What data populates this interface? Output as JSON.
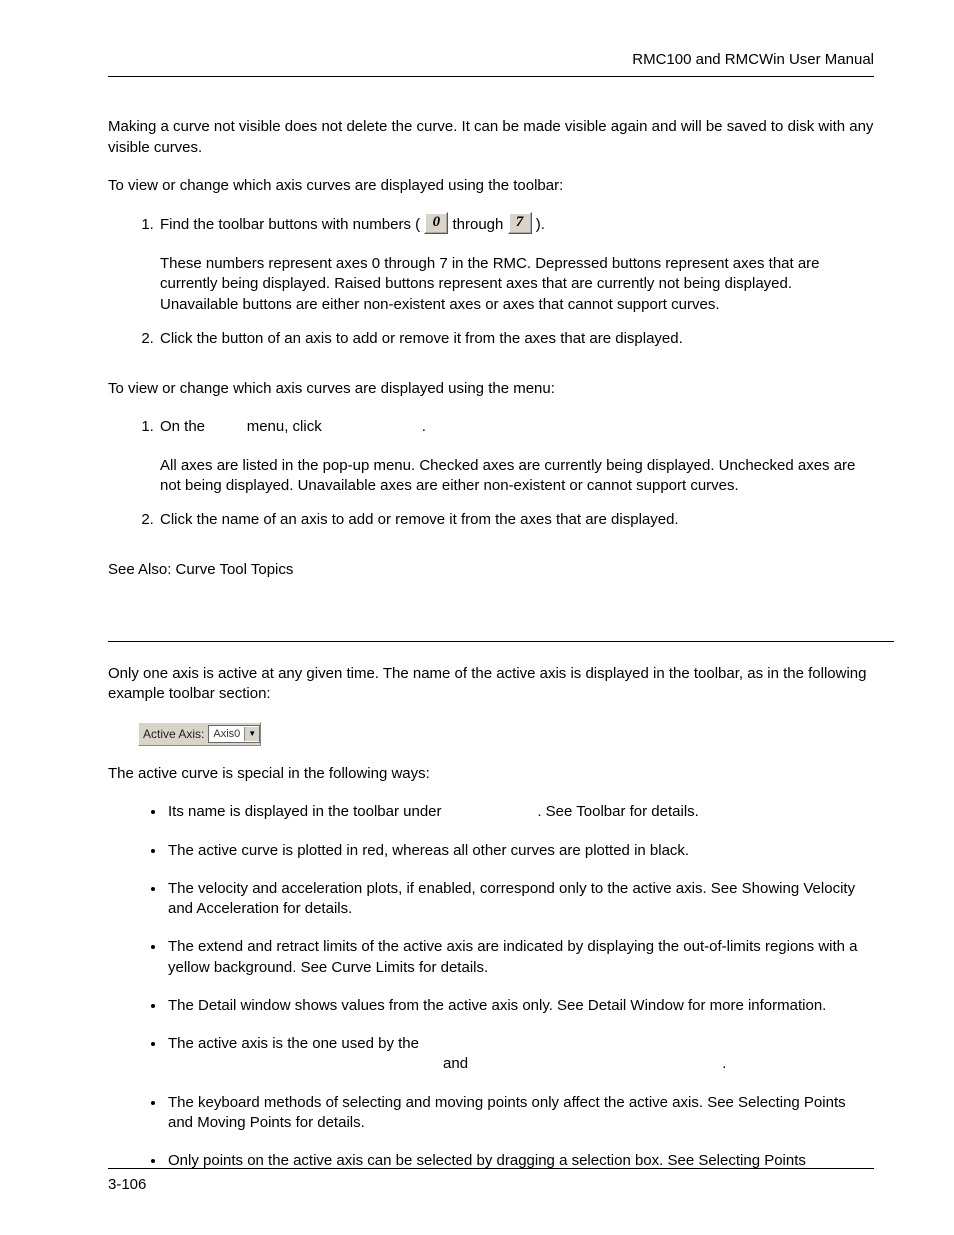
{
  "header": {
    "title": "RMC100 and RMCWin User Manual"
  },
  "section1": {
    "p1": "Making a curve not visible does not delete the curve. It can be made visible again and will be saved to disk with any visible curves.",
    "p2": "To view or change which axis curves are displayed using the toolbar:",
    "list1": {
      "item1_pre": "Find the toolbar buttons with numbers (",
      "item1_mid": " through ",
      "item1_post": ").",
      "item1_sub": "These numbers represent axes 0 through 7 in the RMC. Depressed buttons represent axes that are currently being displayed. Raised buttons represent axes that are currently not being displayed. Unavailable buttons are either non-existent axes or axes that cannot support curves.",
      "item2": "Click the button of an axis to add or remove it from the axes that are displayed."
    },
    "p3": "To view or change which axis curves are displayed using the menu:",
    "list2": {
      "item1": "On the          menu, click                        .",
      "item1_sub": "All axes are listed in the pop-up menu. Checked axes are currently being displayed. Unchecked axes are not being displayed. Unavailable axes are either non-existent or cannot support curves.",
      "item2": "Click the name of an axis to add or remove it from the axes that are displayed."
    },
    "see_also": "See Also: Curve Tool Topics"
  },
  "toolbar_icons": {
    "zero": "0",
    "seven": "7"
  },
  "toolbar_example": {
    "label": "Active Axis:",
    "value": "Axis0"
  },
  "section2": {
    "p1": "Only one axis is active at any given time. The name of the active axis is displayed in the toolbar, as in the following example toolbar section:",
    "p2": "The active curve is special in the following ways:",
    "bullets": {
      "b1": "Its name is displayed in the toolbar under                       . See Toolbar for details.",
      "b2": "The active curve is plotted in red, whereas all other curves are plotted in black.",
      "b3": "The velocity and acceleration plots, if enabled, correspond only to the active axis. See Showing Velocity and Acceleration for details.",
      "b4": "The extend and retract limits of the active axis are indicated by displaying the out-of-limits regions with a yellow background. See Curve Limits for details.",
      "b5": "The Detail window shows values from the active axis only. See Detail Window for more information.",
      "b6a": "The active axis is the one used by the ",
      "b6b": "                                                                  and                                                             .",
      "b7": "The keyboard methods of selecting and moving points only affect the active axis. See Selecting Points and Moving Points for details.",
      "b8": "Only points on the active axis can be selected by dragging a selection box. See Selecting Points"
    }
  },
  "footer": {
    "page": "3-106"
  }
}
